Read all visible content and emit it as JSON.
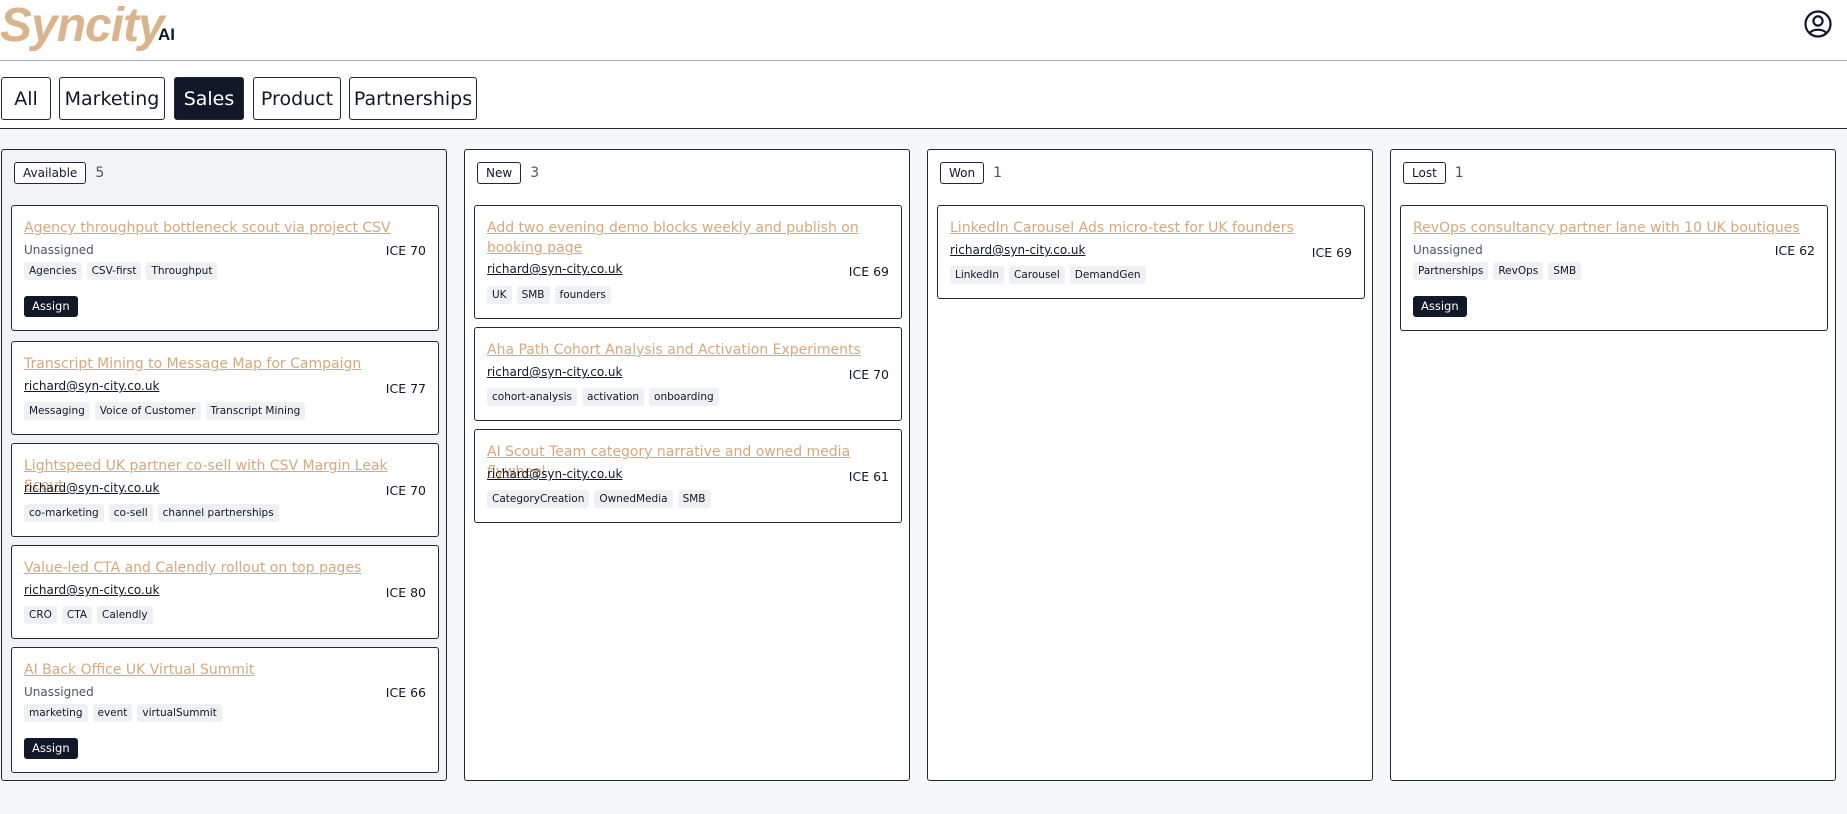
{
  "app": {
    "logo_text": "Syncity",
    "logo_suffix": "AI",
    "user_icon": "user-circle-icon"
  },
  "tabs": [
    {
      "label": "All",
      "active": false
    },
    {
      "label": "Marketing",
      "active": false
    },
    {
      "label": "Sales",
      "active": true
    },
    {
      "label": "Product",
      "active": false
    },
    {
      "label": "Partnerships",
      "active": false
    }
  ],
  "columns": [
    {
      "status": "Available",
      "count": "5",
      "cards": [
        {
          "title": "Agency throughput bottleneck scout via project CSV",
          "owner": "Unassigned",
          "ice": "ICE 70",
          "tags": [
            "Agencies",
            "CSV-first",
            "Throughput"
          ],
          "assign_label": "Assign"
        },
        {
          "title": "Transcript Mining to Message Map for Campaign",
          "owner": "richard@syn-city.co.uk",
          "ice": "ICE 77",
          "tags": [
            "Messaging",
            "Voice of Customer",
            "Transcript Mining"
          ]
        },
        {
          "title": "Lightspeed UK partner co-sell with CSV Margin Leak Scout",
          "owner": "richard@syn-city.co.uk",
          "ice": "ICE 70",
          "tags": [
            "co-marketing",
            "co-sell",
            "channel partnerships"
          ]
        },
        {
          "title": "Value-led CTA and Calendly rollout on top pages",
          "owner": "richard@syn-city.co.uk",
          "ice": "ICE 80",
          "tags": [
            "CRO",
            "CTA",
            "Calendly"
          ]
        },
        {
          "title": "AI Back Office UK Virtual Summit",
          "owner": "Unassigned",
          "ice": "ICE 66",
          "tags": [
            "marketing",
            "event",
            "virtualSummit"
          ],
          "assign_label": "Assign"
        }
      ]
    },
    {
      "status": "New",
      "count": "3",
      "cards": [
        {
          "title": "Add two evening demo blocks weekly and publish on booking page",
          "owner": "richard@syn-city.co.uk",
          "ice": "ICE 69",
          "tags": [
            "UK",
            "SMB",
            "founders"
          ]
        },
        {
          "title": "Aha Path Cohort Analysis and Activation Experiments",
          "owner": "richard@syn-city.co.uk",
          "ice": "ICE 70",
          "tags": [
            "cohort-analysis",
            "activation",
            "onboarding"
          ]
        },
        {
          "title": "AI Scout Team category narrative and owned media flywheel",
          "owner": "richard@syn-city.co.uk",
          "ice": "ICE 61",
          "tags": [
            "CategoryCreation",
            "OwnedMedia",
            "SMB"
          ]
        }
      ]
    },
    {
      "status": "Won",
      "count": "1",
      "cards": [
        {
          "title": "LinkedIn Carousel Ads micro-test for UK founders",
          "owner": "richard@syn-city.co.uk",
          "ice": "ICE 69",
          "tags": [
            "LinkedIn",
            "Carousel",
            "DemandGen"
          ]
        }
      ]
    },
    {
      "status": "Lost",
      "count": "1",
      "cards": [
        {
          "title": "RevOps consultancy partner lane with 10 UK boutiques",
          "owner": "Unassigned",
          "ice": "ICE 62",
          "tags": [
            "Partnerships",
            "RevOps",
            "SMB"
          ],
          "assign_label": "Assign"
        }
      ]
    }
  ]
}
